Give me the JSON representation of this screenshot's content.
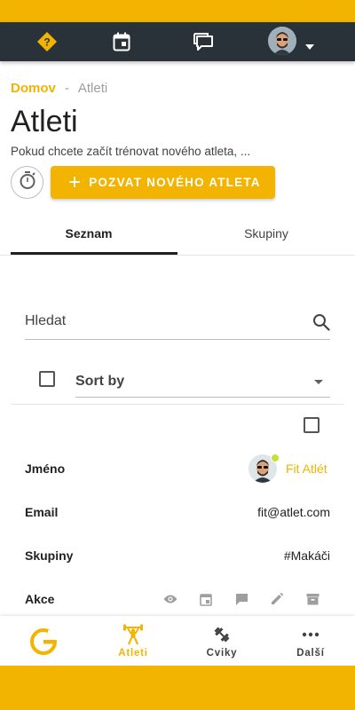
{
  "colors": {
    "accent": "#f2b400",
    "topbar": "#283238",
    "online": "#c5e03a"
  },
  "topbar": {
    "icons": [
      "help-icon",
      "calendar-icon",
      "chat-icon",
      "user-avatar",
      "dropdown-caret-icon"
    ]
  },
  "breadcrumb": {
    "home": "Domov",
    "separator": "-",
    "current": "Atleti"
  },
  "page": {
    "title": "Atleti",
    "subtitle": "Pokud chcete začít trénovat nového atleta, ...",
    "invite_button": "POZVAT NOVÉHO ATLETA"
  },
  "tabs": {
    "list": "Seznam",
    "groups": "Skupiny"
  },
  "search": {
    "placeholder": "Hledat"
  },
  "sort": {
    "label": "Sort by"
  },
  "athlete": {
    "name_label": "Jméno",
    "name": "Fit Atlét",
    "email_label": "Email",
    "email": "fit@atlet.com",
    "groups_label": "Skupiny",
    "groups": "#Makáči",
    "actions_label": "Akce",
    "action_icons": [
      "view-icon",
      "calendar-icon",
      "message-icon",
      "edit-icon",
      "archive-icon"
    ]
  },
  "bottom_nav": {
    "athletes": "Atleti",
    "exercises": "Cviky",
    "more": "Další"
  }
}
